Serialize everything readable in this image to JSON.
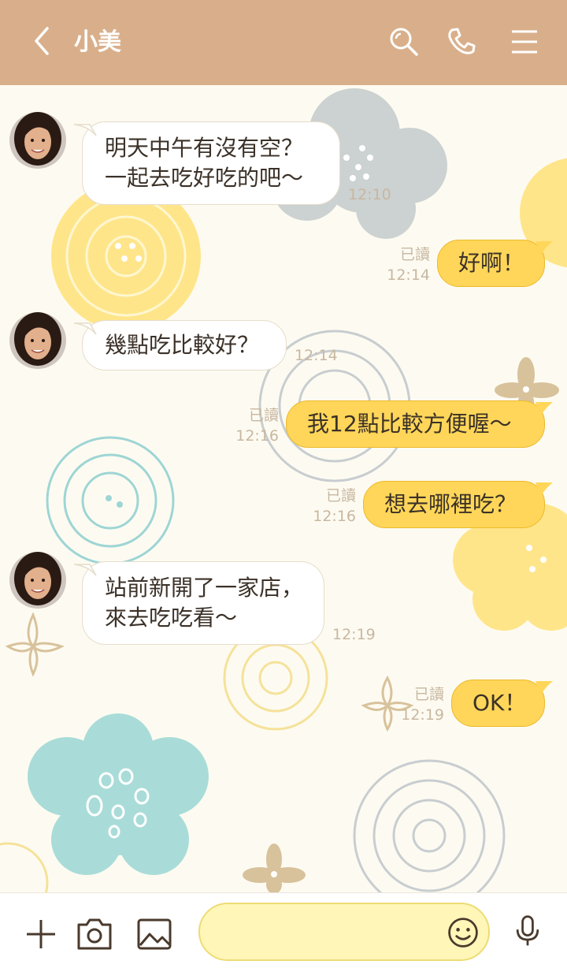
{
  "header": {
    "title": "小美",
    "icons": [
      "back-chevron-icon",
      "search-icon",
      "phone-icon",
      "menu-icon"
    ]
  },
  "messages": [
    {
      "side": "in",
      "lines": [
        "明天中午有沒有空？",
        "一起去吃好吃的吧〜"
      ],
      "time": "12:10"
    },
    {
      "side": "out",
      "text": "好啊！",
      "read": "已讀",
      "time": "12:14"
    },
    {
      "side": "in",
      "lines": [
        "幾點吃比較好？"
      ],
      "time": "12:14"
    },
    {
      "side": "out",
      "text": "我12點比較方便喔〜",
      "read": "已讀",
      "time": "12:16"
    },
    {
      "side": "out",
      "text": "想去哪裡吃？",
      "read": "已讀",
      "time": "12:16"
    },
    {
      "side": "in",
      "lines": [
        "站前新開了一家店，",
        "來去吃吃看〜"
      ],
      "time": "12:19"
    },
    {
      "side": "out",
      "text": "OK！",
      "read": "已讀",
      "time": "12:19"
    }
  ],
  "toolbar": {
    "icons": [
      "plus-icon",
      "camera-icon",
      "image-icon",
      "emoji-icon",
      "microphone-icon"
    ],
    "input_value": ""
  },
  "colors": {
    "header": "#d9af8b",
    "outgoing_bubble": "#ffd659",
    "incoming_bubble": "#ffffff",
    "input_bg": "#fff6b8"
  }
}
